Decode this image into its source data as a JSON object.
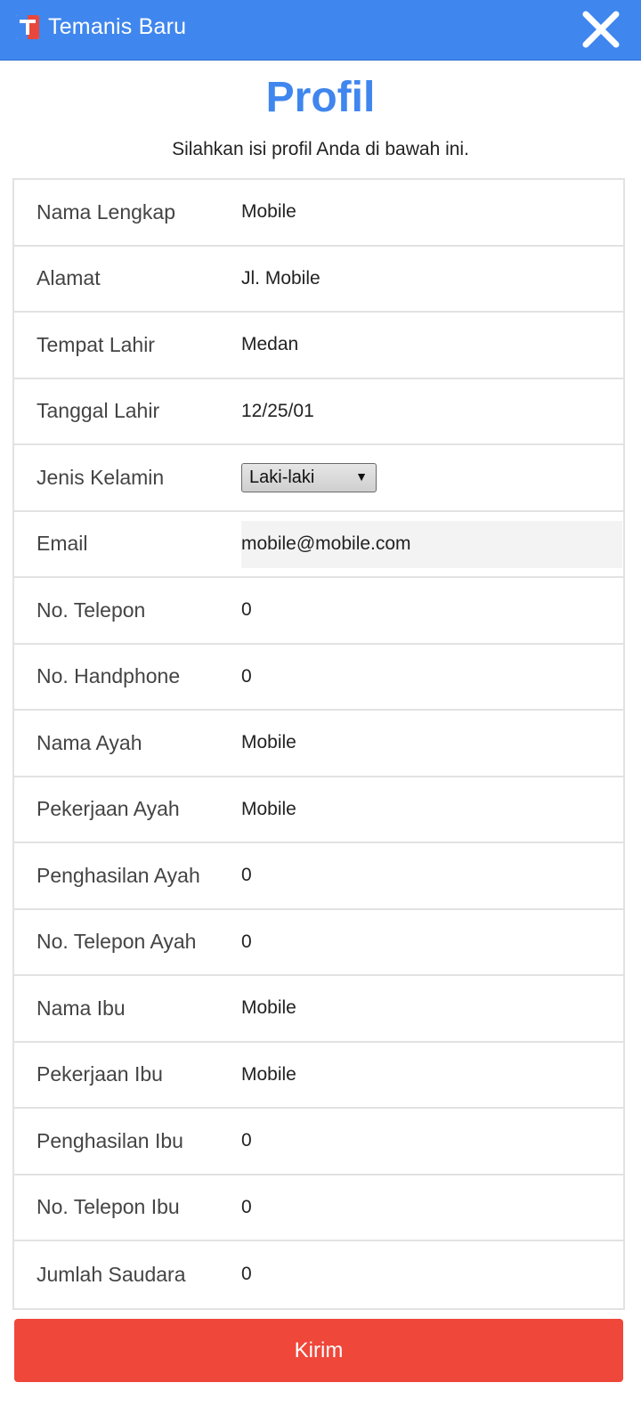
{
  "app_bar": {
    "title": "Temanis Baru",
    "logo_icon": "temanis-logo-icon",
    "close_icon": "close-icon",
    "color": "#3f86ee"
  },
  "heading": "Profil",
  "subtitle": "Silahkan isi profil Anda di bawah ini.",
  "fields": [
    {
      "label": "Nama Lengkap",
      "value": "Mobile"
    },
    {
      "label": "Alamat",
      "value": "Jl. Mobile"
    },
    {
      "label": "Tempat Lahir",
      "value": "Medan"
    },
    {
      "label": "Tanggal Lahir",
      "value": "12/25/01"
    },
    {
      "label": "Jenis Kelamin",
      "value": "Laki-laki"
    },
    {
      "label": "Email",
      "value": "mobile@mobile.com"
    },
    {
      "label": "No. Telepon",
      "value": "0"
    },
    {
      "label": "No. Handphone",
      "value": "0"
    },
    {
      "label": "Nama Ayah",
      "value": "Mobile"
    },
    {
      "label": "Pekerjaan Ayah",
      "value": "Mobile"
    },
    {
      "label": "Penghasilan Ayah",
      "value": "0"
    },
    {
      "label": "No. Telepon Ayah",
      "value": "0"
    },
    {
      "label": "Nama Ibu",
      "value": "Mobile"
    },
    {
      "label": "Pekerjaan Ibu",
      "value": "Mobile"
    },
    {
      "label": "Penghasilan Ibu",
      "value": "0"
    },
    {
      "label": "No. Telepon Ibu",
      "value": "0"
    },
    {
      "label": "Jumlah Saudara",
      "value": "0"
    }
  ],
  "submit_label": "Kirim",
  "submit_color": "#ef473a"
}
